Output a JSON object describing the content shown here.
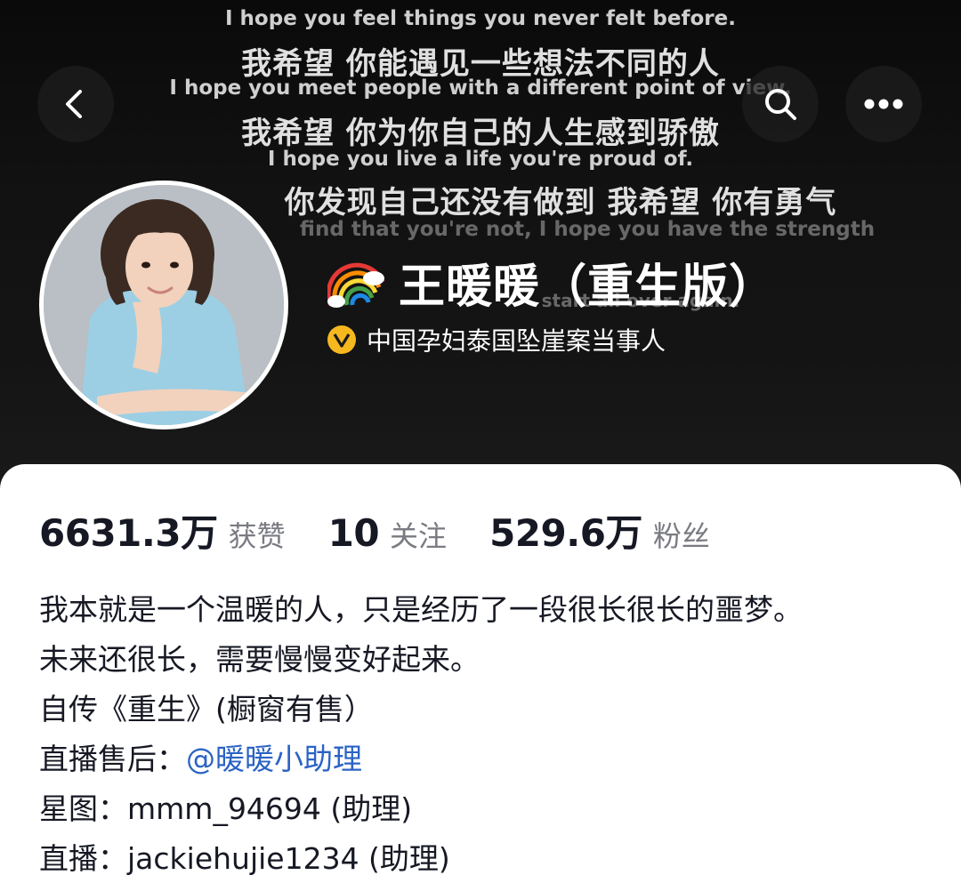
{
  "banner": {
    "lines": [
      {
        "text": "I hope you feel things you never felt before.",
        "kind": "en"
      },
      {
        "text": "我希望 你能遇见一些想法不同的人",
        "kind": "zh"
      },
      {
        "text": "I hope you meet people with a different point of view.",
        "kind": "en"
      },
      {
        "text": "我希望 你为你自己的人生感到骄傲",
        "kind": "zh"
      },
      {
        "text": "I hope you live a life you're proud of.",
        "kind": "en"
      },
      {
        "text": "你发现自己还没有做到 我希望 你有勇气",
        "kind": "zh"
      },
      {
        "text": "find that you're not, I hope you have the strength",
        "kind": "en"
      },
      {
        "text": "start all over again.",
        "kind": "en"
      }
    ]
  },
  "nav": {
    "back_icon": "chevron-left-icon",
    "search_icon": "search-icon",
    "more_icon": "more-dots-icon"
  },
  "profile": {
    "name": "王暖暖（重生版）",
    "name_emoji": "rainbow-icon",
    "verified_text": "中国孕妇泰国坠崖案当事人",
    "verified_color": "#f5b81f"
  },
  "stats": [
    {
      "value": "6631.3万",
      "label": "获赞"
    },
    {
      "value": "10",
      "label": "关注"
    },
    {
      "value": "529.6万",
      "label": "粉丝"
    }
  ],
  "bio": {
    "line1": "我本就是一个温暖的人，只是经历了一段很长很长的噩梦。",
    "line2": "未来还很长，需要慢慢变好起来。",
    "line3": "自传《重生》(橱窗有售）",
    "line4_prefix": "直播售后：",
    "line4_link": "@暖暖小助理",
    "line5": "星图：mmm_94694 (助理)",
    "line6": "直播：jackiehujie1234 (助理)"
  },
  "colors": {
    "link": "#2b63c4",
    "card_bg": "#ffffff",
    "header_bg": "#0b0b0c"
  }
}
